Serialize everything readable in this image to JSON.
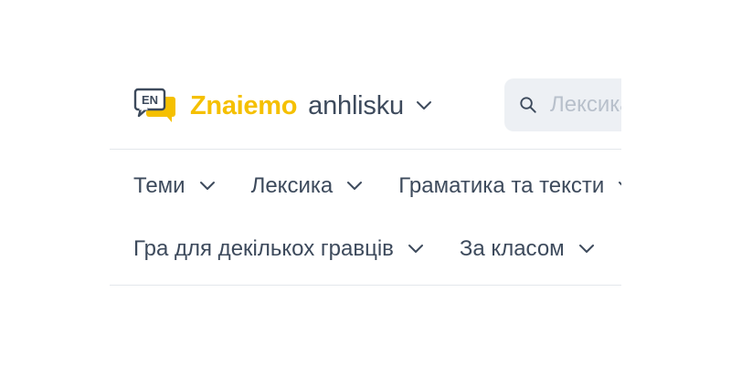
{
  "header": {
    "logo_badge": "EN",
    "brand_primary": "Znaiemo",
    "brand_secondary": "anhlisku",
    "brand_color": "#f5c000",
    "text_color": "#3d4a5c",
    "search": {
      "placeholder": "Лексика",
      "value": "",
      "icon": "search-icon"
    }
  },
  "nav": {
    "row1": [
      {
        "label": "Теми",
        "icon": "chevron-down-icon"
      },
      {
        "label": "Лексика",
        "icon": "chevron-down-icon"
      },
      {
        "label": "Граматика та тексти",
        "icon": "chevron-down-icon"
      }
    ],
    "row2": [
      {
        "label": "Гра для декількох гравців",
        "icon": "chevron-down-icon"
      },
      {
        "label": "За класом",
        "icon": "chevron-down-icon"
      }
    ]
  }
}
